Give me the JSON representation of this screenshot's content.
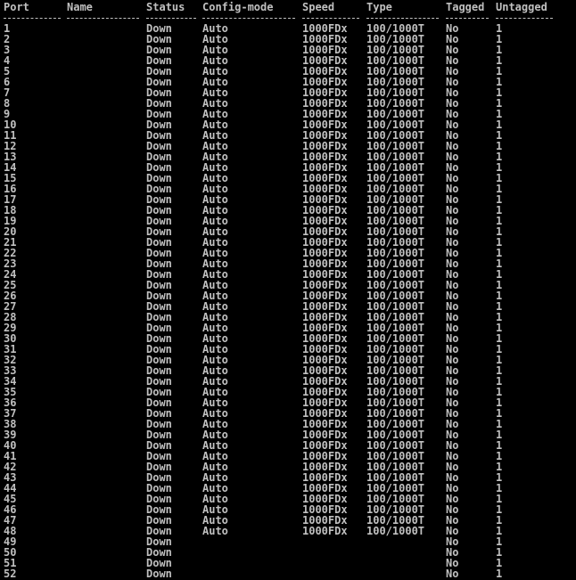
{
  "header": {
    "columns": [
      "Port",
      "Name",
      "Status",
      "Config-mode",
      "Speed",
      "Type",
      "Tagged",
      "Untagged"
    ]
  },
  "rows": [
    {
      "port": "1",
      "name": "",
      "status": "Down",
      "config_mode": "Auto",
      "speed": "1000FDx",
      "type": "100/1000T",
      "tagged": "No",
      "untagged": "1"
    },
    {
      "port": "2",
      "name": "",
      "status": "Down",
      "config_mode": "Auto",
      "speed": "1000FDx",
      "type": "100/1000T",
      "tagged": "No",
      "untagged": "1"
    },
    {
      "port": "3",
      "name": "",
      "status": "Down",
      "config_mode": "Auto",
      "speed": "1000FDx",
      "type": "100/1000T",
      "tagged": "No",
      "untagged": "1"
    },
    {
      "port": "4",
      "name": "",
      "status": "Down",
      "config_mode": "Auto",
      "speed": "1000FDx",
      "type": "100/1000T",
      "tagged": "No",
      "untagged": "1"
    },
    {
      "port": "5",
      "name": "",
      "status": "Down",
      "config_mode": "Auto",
      "speed": "1000FDx",
      "type": "100/1000T",
      "tagged": "No",
      "untagged": "1"
    },
    {
      "port": "6",
      "name": "",
      "status": "Down",
      "config_mode": "Auto",
      "speed": "1000FDx",
      "type": "100/1000T",
      "tagged": "No",
      "untagged": "1"
    },
    {
      "port": "7",
      "name": "",
      "status": "Down",
      "config_mode": "Auto",
      "speed": "1000FDx",
      "type": "100/1000T",
      "tagged": "No",
      "untagged": "1"
    },
    {
      "port": "8",
      "name": "",
      "status": "Down",
      "config_mode": "Auto",
      "speed": "1000FDx",
      "type": "100/1000T",
      "tagged": "No",
      "untagged": "1"
    },
    {
      "port": "9",
      "name": "",
      "status": "Down",
      "config_mode": "Auto",
      "speed": "1000FDx",
      "type": "100/1000T",
      "tagged": "No",
      "untagged": "1"
    },
    {
      "port": "10",
      "name": "",
      "status": "Down",
      "config_mode": "Auto",
      "speed": "1000FDx",
      "type": "100/1000T",
      "tagged": "No",
      "untagged": "1"
    },
    {
      "port": "11",
      "name": "",
      "status": "Down",
      "config_mode": "Auto",
      "speed": "1000FDx",
      "type": "100/1000T",
      "tagged": "No",
      "untagged": "1"
    },
    {
      "port": "12",
      "name": "",
      "status": "Down",
      "config_mode": "Auto",
      "speed": "1000FDx",
      "type": "100/1000T",
      "tagged": "No",
      "untagged": "1"
    },
    {
      "port": "13",
      "name": "",
      "status": "Down",
      "config_mode": "Auto",
      "speed": "1000FDx",
      "type": "100/1000T",
      "tagged": "No",
      "untagged": "1"
    },
    {
      "port": "14",
      "name": "",
      "status": "Down",
      "config_mode": "Auto",
      "speed": "1000FDx",
      "type": "100/1000T",
      "tagged": "No",
      "untagged": "1"
    },
    {
      "port": "15",
      "name": "",
      "status": "Down",
      "config_mode": "Auto",
      "speed": "1000FDx",
      "type": "100/1000T",
      "tagged": "No",
      "untagged": "1"
    },
    {
      "port": "16",
      "name": "",
      "status": "Down",
      "config_mode": "Auto",
      "speed": "1000FDx",
      "type": "100/1000T",
      "tagged": "No",
      "untagged": "1"
    },
    {
      "port": "17",
      "name": "",
      "status": "Down",
      "config_mode": "Auto",
      "speed": "1000FDx",
      "type": "100/1000T",
      "tagged": "No",
      "untagged": "1"
    },
    {
      "port": "18",
      "name": "",
      "status": "Down",
      "config_mode": "Auto",
      "speed": "1000FDx",
      "type": "100/1000T",
      "tagged": "No",
      "untagged": "1"
    },
    {
      "port": "19",
      "name": "",
      "status": "Down",
      "config_mode": "Auto",
      "speed": "1000FDx",
      "type": "100/1000T",
      "tagged": "No",
      "untagged": "1"
    },
    {
      "port": "20",
      "name": "",
      "status": "Down",
      "config_mode": "Auto",
      "speed": "1000FDx",
      "type": "100/1000T",
      "tagged": "No",
      "untagged": "1"
    },
    {
      "port": "21",
      "name": "",
      "status": "Down",
      "config_mode": "Auto",
      "speed": "1000FDx",
      "type": "100/1000T",
      "tagged": "No",
      "untagged": "1"
    },
    {
      "port": "22",
      "name": "",
      "status": "Down",
      "config_mode": "Auto",
      "speed": "1000FDx",
      "type": "100/1000T",
      "tagged": "No",
      "untagged": "1"
    },
    {
      "port": "23",
      "name": "",
      "status": "Down",
      "config_mode": "Auto",
      "speed": "1000FDx",
      "type": "100/1000T",
      "tagged": "No",
      "untagged": "1"
    },
    {
      "port": "24",
      "name": "",
      "status": "Down",
      "config_mode": "Auto",
      "speed": "1000FDx",
      "type": "100/1000T",
      "tagged": "No",
      "untagged": "1"
    },
    {
      "port": "25",
      "name": "",
      "status": "Down",
      "config_mode": "Auto",
      "speed": "1000FDx",
      "type": "100/1000T",
      "tagged": "No",
      "untagged": "1"
    },
    {
      "port": "26",
      "name": "",
      "status": "Down",
      "config_mode": "Auto",
      "speed": "1000FDx",
      "type": "100/1000T",
      "tagged": "No",
      "untagged": "1"
    },
    {
      "port": "27",
      "name": "",
      "status": "Down",
      "config_mode": "Auto",
      "speed": "1000FDx",
      "type": "100/1000T",
      "tagged": "No",
      "untagged": "1"
    },
    {
      "port": "28",
      "name": "",
      "status": "Down",
      "config_mode": "Auto",
      "speed": "1000FDx",
      "type": "100/1000T",
      "tagged": "No",
      "untagged": "1"
    },
    {
      "port": "29",
      "name": "",
      "status": "Down",
      "config_mode": "Auto",
      "speed": "1000FDx",
      "type": "100/1000T",
      "tagged": "No",
      "untagged": "1"
    },
    {
      "port": "30",
      "name": "",
      "status": "Down",
      "config_mode": "Auto",
      "speed": "1000FDx",
      "type": "100/1000T",
      "tagged": "No",
      "untagged": "1"
    },
    {
      "port": "31",
      "name": "",
      "status": "Down",
      "config_mode": "Auto",
      "speed": "1000FDx",
      "type": "100/1000T",
      "tagged": "No",
      "untagged": "1"
    },
    {
      "port": "32",
      "name": "",
      "status": "Down",
      "config_mode": "Auto",
      "speed": "1000FDx",
      "type": "100/1000T",
      "tagged": "No",
      "untagged": "1"
    },
    {
      "port": "33",
      "name": "",
      "status": "Down",
      "config_mode": "Auto",
      "speed": "1000FDx",
      "type": "100/1000T",
      "tagged": "No",
      "untagged": "1"
    },
    {
      "port": "34",
      "name": "",
      "status": "Down",
      "config_mode": "Auto",
      "speed": "1000FDx",
      "type": "100/1000T",
      "tagged": "No",
      "untagged": "1"
    },
    {
      "port": "35",
      "name": "",
      "status": "Down",
      "config_mode": "Auto",
      "speed": "1000FDx",
      "type": "100/1000T",
      "tagged": "No",
      "untagged": "1"
    },
    {
      "port": "36",
      "name": "",
      "status": "Down",
      "config_mode": "Auto",
      "speed": "1000FDx",
      "type": "100/1000T",
      "tagged": "No",
      "untagged": "1"
    },
    {
      "port": "37",
      "name": "",
      "status": "Down",
      "config_mode": "Auto",
      "speed": "1000FDx",
      "type": "100/1000T",
      "tagged": "No",
      "untagged": "1"
    },
    {
      "port": "38",
      "name": "",
      "status": "Down",
      "config_mode": "Auto",
      "speed": "1000FDx",
      "type": "100/1000T",
      "tagged": "No",
      "untagged": "1"
    },
    {
      "port": "39",
      "name": "",
      "status": "Down",
      "config_mode": "Auto",
      "speed": "1000FDx",
      "type": "100/1000T",
      "tagged": "No",
      "untagged": "1"
    },
    {
      "port": "40",
      "name": "",
      "status": "Down",
      "config_mode": "Auto",
      "speed": "1000FDx",
      "type": "100/1000T",
      "tagged": "No",
      "untagged": "1"
    },
    {
      "port": "41",
      "name": "",
      "status": "Down",
      "config_mode": "Auto",
      "speed": "1000FDx",
      "type": "100/1000T",
      "tagged": "No",
      "untagged": "1"
    },
    {
      "port": "42",
      "name": "",
      "status": "Down",
      "config_mode": "Auto",
      "speed": "1000FDx",
      "type": "100/1000T",
      "tagged": "No",
      "untagged": "1"
    },
    {
      "port": "43",
      "name": "",
      "status": "Down",
      "config_mode": "Auto",
      "speed": "1000FDx",
      "type": "100/1000T",
      "tagged": "No",
      "untagged": "1"
    },
    {
      "port": "44",
      "name": "",
      "status": "Down",
      "config_mode": "Auto",
      "speed": "1000FDx",
      "type": "100/1000T",
      "tagged": "No",
      "untagged": "1"
    },
    {
      "port": "45",
      "name": "",
      "status": "Down",
      "config_mode": "Auto",
      "speed": "1000FDx",
      "type": "100/1000T",
      "tagged": "No",
      "untagged": "1"
    },
    {
      "port": "46",
      "name": "",
      "status": "Down",
      "config_mode": "Auto",
      "speed": "1000FDx",
      "type": "100/1000T",
      "tagged": "No",
      "untagged": "1"
    },
    {
      "port": "47",
      "name": "",
      "status": "Down",
      "config_mode": "Auto",
      "speed": "1000FDx",
      "type": "100/1000T",
      "tagged": "No",
      "untagged": "1"
    },
    {
      "port": "48",
      "name": "",
      "status": "Down",
      "config_mode": "Auto",
      "speed": "1000FDx",
      "type": "100/1000T",
      "tagged": "No",
      "untagged": "1"
    },
    {
      "port": "49",
      "name": "",
      "status": "Down",
      "config_mode": "",
      "speed": "",
      "type": "",
      "tagged": "No",
      "untagged": "1"
    },
    {
      "port": "50",
      "name": "",
      "status": "Down",
      "config_mode": "",
      "speed": "",
      "type": "",
      "tagged": "No",
      "untagged": "1"
    },
    {
      "port": "51",
      "name": "",
      "status": "Down",
      "config_mode": "",
      "speed": "",
      "type": "",
      "tagged": "No",
      "untagged": "1"
    },
    {
      "port": "52",
      "name": "",
      "status": "Down",
      "config_mode": "",
      "speed": "",
      "type": "",
      "tagged": "No",
      "untagged": "1"
    }
  ]
}
